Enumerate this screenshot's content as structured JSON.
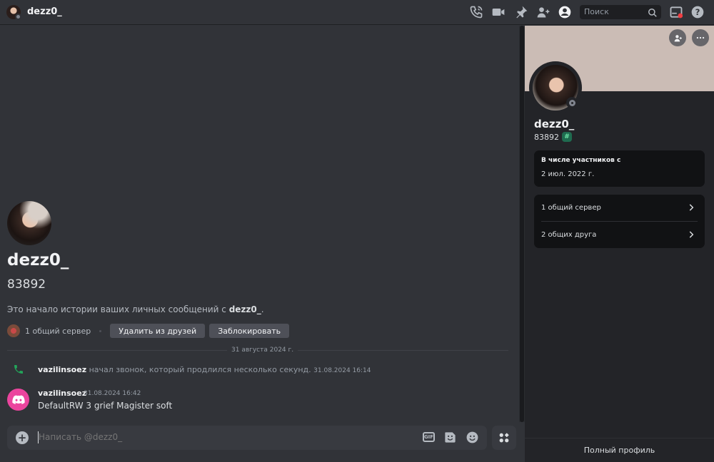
{
  "topbar": {
    "username": "dezz0_",
    "search_placeholder": "Поиск",
    "icons": [
      "voice-call-icon",
      "video-call-icon",
      "pin-icon",
      "add-friends-to-dm-icon",
      "user-profile-icon",
      "search-icon",
      "inbox-icon",
      "help-icon"
    ]
  },
  "hero": {
    "name": "dezz0_",
    "tag": "83892",
    "intro_prefix": "Это начало истории ваших личных сообщений с ",
    "intro_name": "dezz0_",
    "intro_suffix": ".",
    "mutual_servers": "1 общий сервер",
    "remove_friend": "Удалить из друзей",
    "block": "Заблокировать"
  },
  "date_divider": "31 августа 2024 г.",
  "call_message": {
    "author": "vazilinsoez",
    "text": " начал звонок, который продлился несколько секунд.",
    "timestamp": "31.08.2024 16:14"
  },
  "message": {
    "author": "vazilinsoez",
    "timestamp": "31.08.2024 16:42",
    "text": "DefaultRW 3 grief Magister soft"
  },
  "composer": {
    "placeholder": "Написать @dezz0_",
    "gif_label": "GIF"
  },
  "profile": {
    "name": "dezz0_",
    "tag": "83892",
    "badge": "#",
    "member_since_label": "В числе участников с",
    "member_since_value": "2 июл. 2022 г.",
    "mutual_servers": "1 общий сервер",
    "mutual_friends": "2 общих друга",
    "full_profile": "Полный профиль",
    "banner_color": "#cbbcb5"
  },
  "colors": {
    "accent_call": "#23a55a",
    "discord_avatar": "#eb459e",
    "notification": "#f23f43"
  }
}
